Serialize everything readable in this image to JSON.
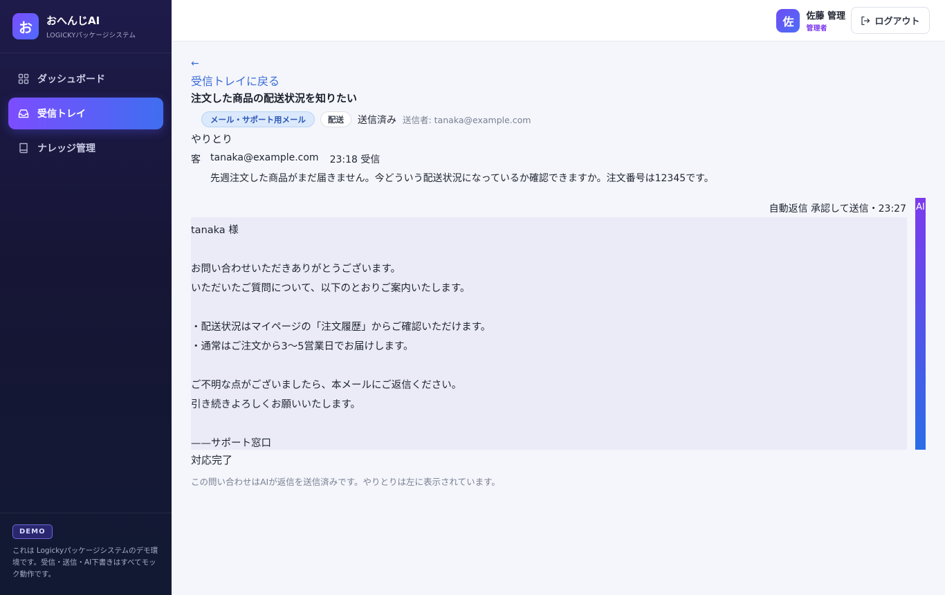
{
  "brand": {
    "logo": "お",
    "name": "おへんじAI",
    "sub": "LOGICKYパッケージシステム"
  },
  "nav": [
    {
      "label": "ダッシュボード",
      "icon": "grid-icon",
      "active": false
    },
    {
      "label": "受信トレイ",
      "icon": "inbox-icon",
      "active": true
    },
    {
      "label": "ナレッジ管理",
      "icon": "book-icon",
      "active": false
    }
  ],
  "demo": {
    "badge": "DEMO",
    "text": "これは Logickyパッケージシステムのデモ環境です。受信・送信・AI下書きはすべてモック動作です。"
  },
  "header": {
    "avatar": "佐",
    "user_name": "佐藤 管理",
    "user_role": "管理者",
    "logout_label": "ログアウト"
  },
  "main": {
    "back_arrow": "←",
    "back_label": "受信トレイに戻る",
    "subject": "注文した商品の配送状況を知りたい",
    "tag_channel": "メール・サポート用メール",
    "tag_category": "配送",
    "status": "送信済み",
    "sender": "送信者: tanaka@example.com",
    "section_label": "やりとり",
    "message": {
      "who": "客",
      "from": "tanaka@example.com",
      "time": "23:18 受信",
      "body": "先週注文した商品がまだ届きません。今どういう配送状況になっているか確認できますか。注文番号は12345です。"
    },
    "reply": {
      "meta": "自動返信 承認して送信・23:27",
      "ai_label": "AI",
      "lines": [
        "tanaka 様",
        "",
        "お問い合わせいただきありがとうございます。",
        "いただいたご質問について、以下のとおりご案内いたします。",
        "",
        "・配送状況はマイページの「注文履歴」からご確認いただけます。",
        "・通常はご注文から3〜5営業日でお届けします。",
        "",
        "ご不明な点がございましたら、本メールにご返信ください。",
        "引き続きよろしくお願いいたします。",
        "",
        "——サポート窓口"
      ]
    },
    "done_label": "対応完了",
    "note": "この問い合わせはAIが返信を送信済みです。やりとりは左に表示されています。"
  }
}
